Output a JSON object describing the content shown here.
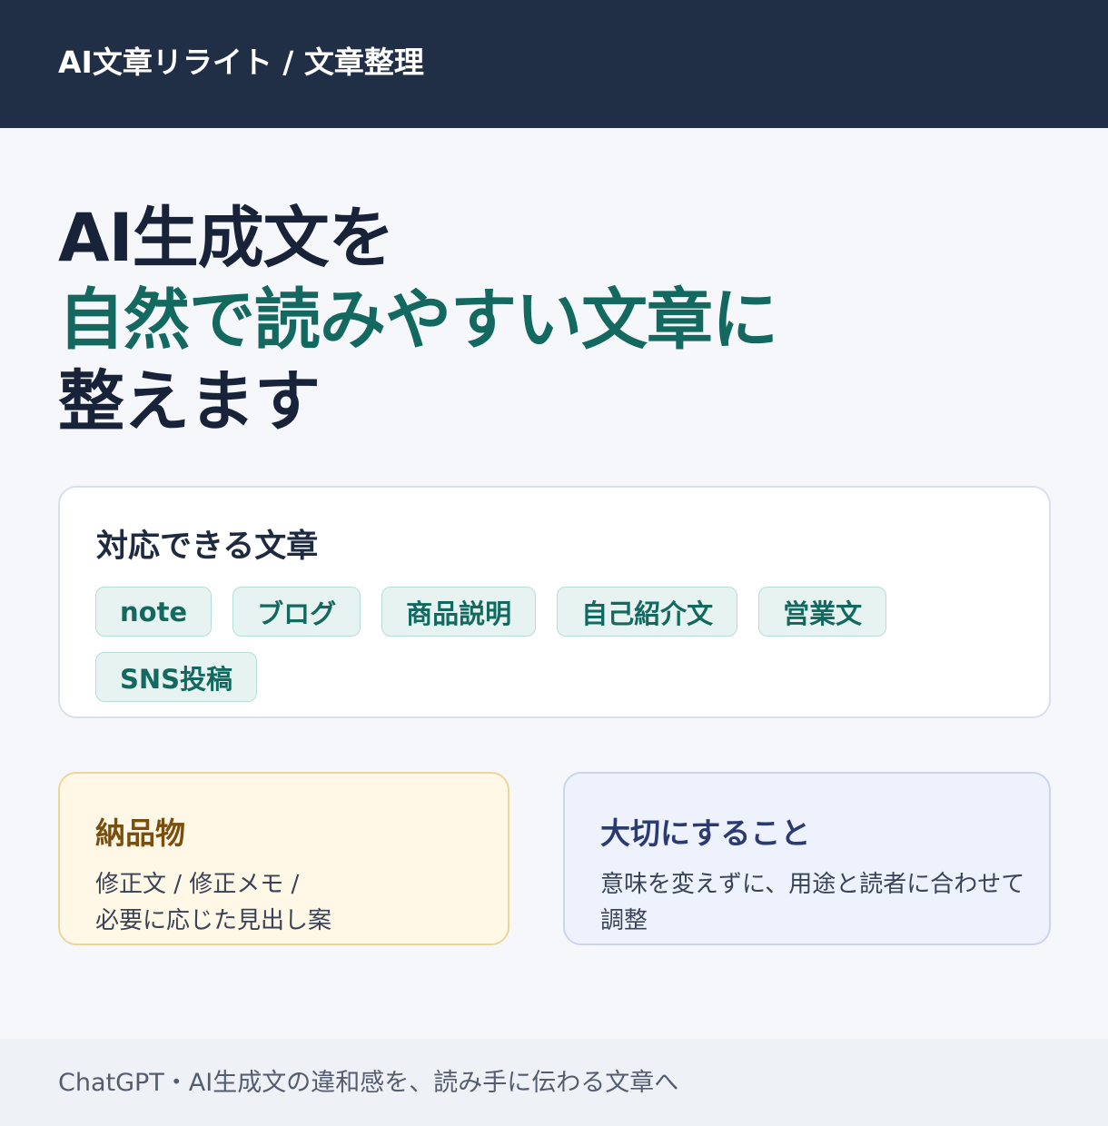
{
  "header": {
    "title": "AI文章リライト / 文章整理"
  },
  "hero": {
    "line1": "AI生成文を",
    "line2": "自然で読みやすい文章に",
    "line3": "整えます"
  },
  "supported": {
    "title": "対応できる文章",
    "chips": [
      "note",
      "ブログ",
      "商品説明",
      "自己紹介文",
      "営業文",
      "SNS投稿"
    ]
  },
  "deliverables": {
    "title": "納品物",
    "body_line1": "修正文 / 修正メモ /",
    "body_line2": "必要に応じた見出し案"
  },
  "principle": {
    "title": "大切にすること",
    "body_line1": "意味を変えずに、用途と読者に合わせて",
    "body_line2": "調整"
  },
  "footer": {
    "text": "ChatGPT・AI生成文の違和感を、読み手に伝わる文章へ"
  },
  "colors": {
    "header_bg": "#202e46",
    "accent_green": "#13695f",
    "deliverables_bg": "#fff8e7",
    "principle_bg": "#edf2fd"
  }
}
